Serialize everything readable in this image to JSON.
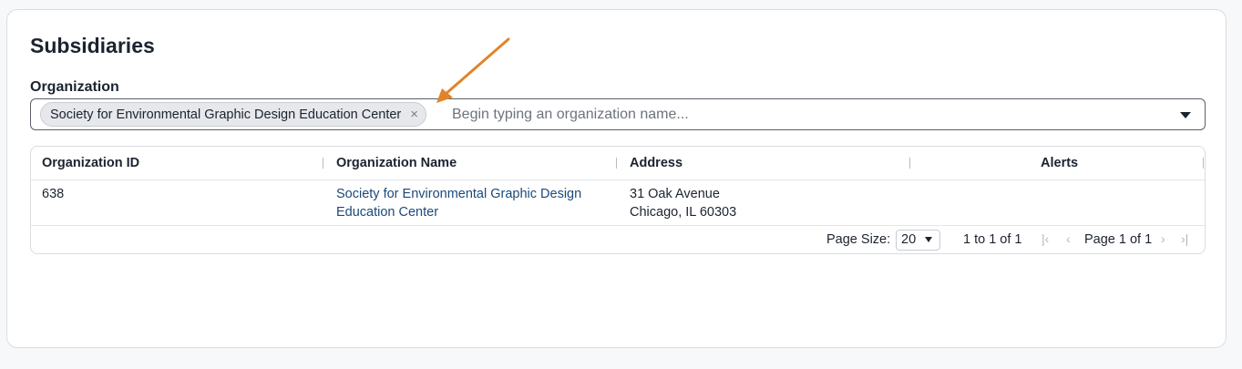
{
  "page": {
    "title": "Subsidiaries"
  },
  "organization_field": {
    "label": "Organization",
    "selected_chip": "Society for Environmental Graphic Design Education Center",
    "remove_glyph": "×",
    "placeholder": "Begin typing an organization name..."
  },
  "grid": {
    "columns": [
      "Organization ID",
      "Organization Name",
      "Address",
      "Alerts"
    ],
    "rows": [
      {
        "org_id": "638",
        "org_name_line1": "Society for Environmental Graphic Design",
        "org_name_line2": "Education Center",
        "address_line1": "31 Oak Avenue",
        "address_line2": "Chicago, IL 60303",
        "alerts": ""
      }
    ],
    "footer": {
      "page_size_label": "Page Size:",
      "page_size_value": "20",
      "range_text": "1 to 1 of 1",
      "page_text": "Page 1 of 1",
      "first_glyph": "|‹",
      "prev_glyph": "‹",
      "next_glyph": "›",
      "last_glyph": "›|"
    }
  },
  "colors": {
    "annotation_arrow": "#e0842a",
    "link": "#1a4a7a"
  }
}
